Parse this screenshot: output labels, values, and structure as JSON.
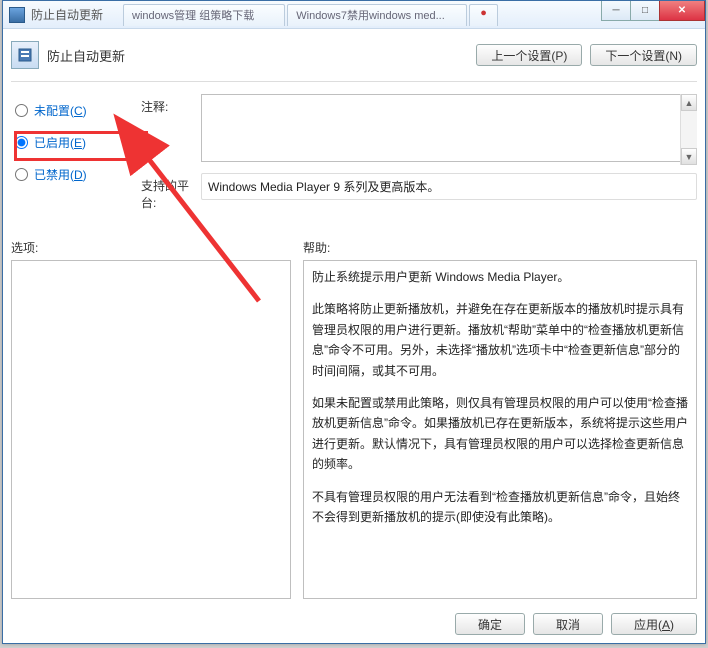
{
  "window": {
    "title": "防止自动更新",
    "tabs": [
      "windows管理 组策略下载",
      "Windows7禁用windows med..."
    ],
    "tab_extra": "●"
  },
  "win_controls": {
    "min": "─",
    "max": "□",
    "close": "✕"
  },
  "page": {
    "icon_name": "policy-icon",
    "title": "防止自动更新",
    "prev_btn": "上一个设置(P)",
    "next_btn": "下一个设置(N)"
  },
  "radios": {
    "not_configured": "未配置(C)",
    "enabled": "已启用(E)",
    "disabled": "已禁用(D)",
    "selected": "enabled"
  },
  "fields": {
    "note_label": "注释:",
    "note_value": "",
    "platform_label": "支持的平台:",
    "platform_value": "Windows Media Player 9 系列及更高版本。"
  },
  "columns": {
    "options_title": "选项:",
    "help_title": "帮助:"
  },
  "help_text": {
    "p1": "防止系统提示用户更新 Windows Media Player。",
    "p2": "此策略将防止更新播放机，并避免在存在更新版本的播放机时提示具有管理员权限的用户进行更新。播放机“帮助”菜单中的“检查播放机更新信息”命令不可用。另外，未选择“播放机”选项卡中“检查更新信息”部分的时间间隔，或其不可用。",
    "p3": "如果未配置或禁用此策略，则仅具有管理员权限的用户可以使用“检查播放机更新信息”命令。如果播放机已存在更新版本，系统将提示这些用户进行更新。默认情况下，具有管理员权限的用户可以选择检查更新信息的频率。",
    "p4": "不具有管理员权限的用户无法看到“检查播放机更新信息”命令，且始终不会得到更新播放机的提示(即使没有此策略)。"
  },
  "footer": {
    "ok": "确定",
    "cancel": "取消",
    "apply": "应用(A)"
  }
}
